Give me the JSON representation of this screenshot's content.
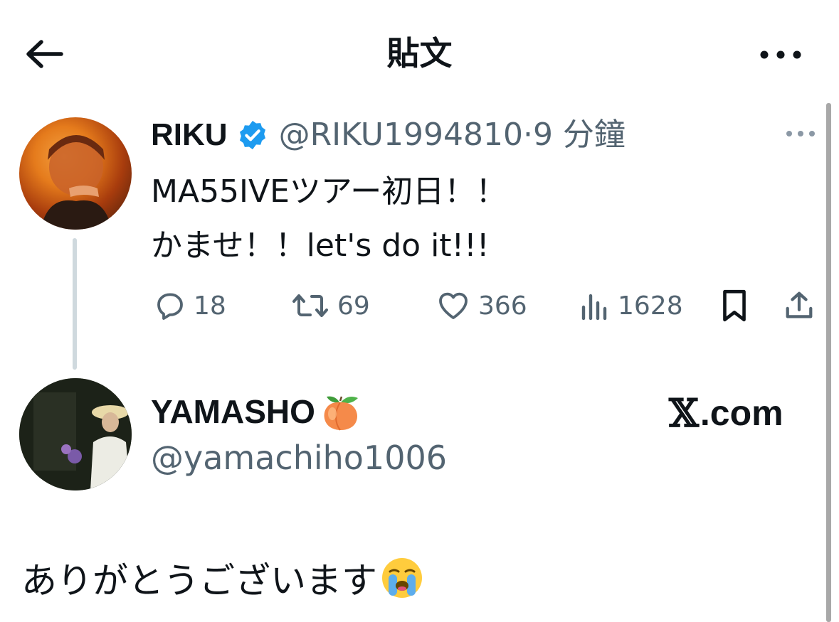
{
  "header": {
    "title": "貼文",
    "back_icon": "arrow-left-icon",
    "more_icon": "more-horizontal-icon"
  },
  "tweet": {
    "display_name": "RIKU",
    "verified_icon": "verified-badge-icon",
    "handle": "@RIKU1994810",
    "separator": "·",
    "time": "9 分鐘",
    "text_line1": "MA55IVEツアー初日！！",
    "text_line2": "かませ！！let's do it!!!",
    "actions": {
      "replies": "18",
      "retweets": "69",
      "likes": "366",
      "views": "1628"
    }
  },
  "reply": {
    "display_name": "YAMASHO",
    "name_emoji": "peach-emoji-icon",
    "handle": "@yamachiho1006",
    "source_x": "𝕏",
    "source_domain": ".com",
    "text": "ありがとうございます",
    "text_emoji": "loudly-crying-face-icon"
  },
  "colors": {
    "text": "#0f1419",
    "secondary": "#536471",
    "verified": "#1d9bf0",
    "thread_line": "#cfd9de"
  }
}
